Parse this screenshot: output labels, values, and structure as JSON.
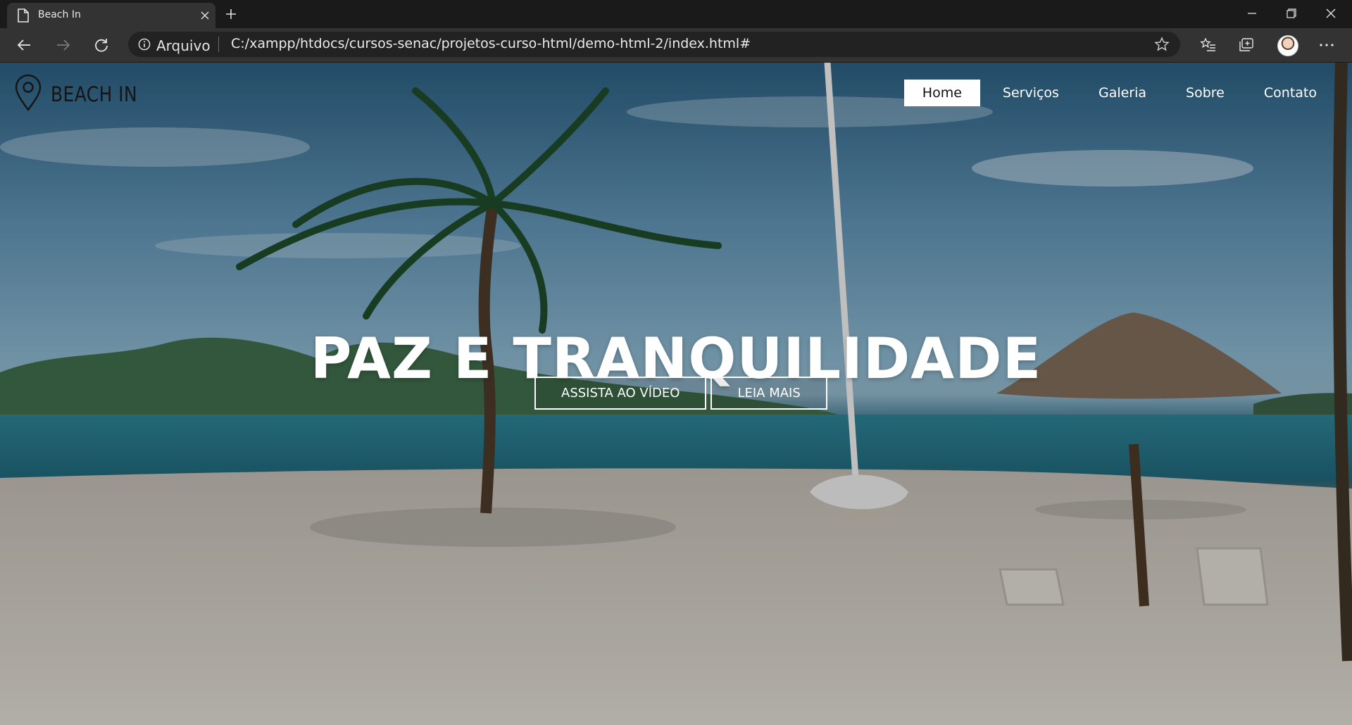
{
  "browser": {
    "tab": {
      "title": "Beach In",
      "page_icon": "page-icon",
      "close_icon": "close-icon"
    },
    "new_tab_icon": "plus-icon",
    "window_controls": [
      "minimize-icon",
      "restore-icon",
      "close-icon"
    ],
    "toolbar": {
      "back_icon": "arrow-left-icon",
      "forward_icon": "arrow-right-icon",
      "refresh_icon": "refresh-icon",
      "site_info_label": "Arquivo",
      "url": "C:/xampp/htdocs/cursos-senac/projetos-curso-html/demo-html-2/index.html#",
      "favorite_icon": "star-icon",
      "favorites_icon": "favorites-list-icon",
      "collections_icon": "collections-icon",
      "more_icon": "more-icon"
    }
  },
  "page": {
    "brand": {
      "name": "BEACH IN",
      "icon": "location-pin-icon"
    },
    "nav": {
      "items": [
        {
          "label": "Home",
          "active": true
        },
        {
          "label": "Serviços"
        },
        {
          "label": "Galeria"
        },
        {
          "label": "Sobre"
        },
        {
          "label": "Contato"
        }
      ]
    },
    "hero": {
      "title": "PAZ E TRANQUILIDADE",
      "buttons": [
        {
          "label": "ASSISTA AO VÍDEO"
        },
        {
          "label": "LEIA MAIS"
        }
      ]
    }
  }
}
